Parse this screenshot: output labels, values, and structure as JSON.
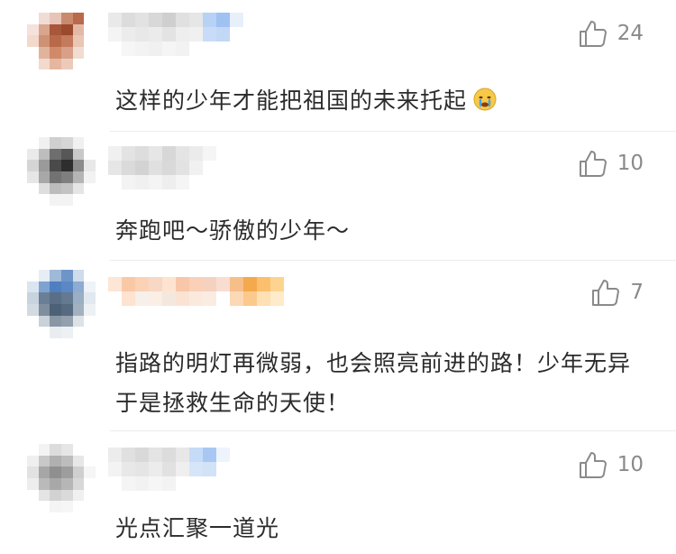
{
  "comments": [
    {
      "text": "这样的少年才能把祖国的未来托起",
      "likes": "24",
      "emoji": "crying-face-emoji"
    },
    {
      "text": "奔跑吧～骄傲的少年～",
      "likes": "10"
    },
    {
      "text": "指路的明灯再微弱，也会照亮前进的路！少年无异于是拯救生命的天使！",
      "likes": "7"
    },
    {
      "text": "光点汇聚一道光",
      "likes": "10"
    }
  ],
  "icons": {
    "like": "thumbs-up-icon"
  },
  "colors": {
    "text": "#2b2b2b",
    "count": "#8a8a8a",
    "divider": "#ececec"
  }
}
